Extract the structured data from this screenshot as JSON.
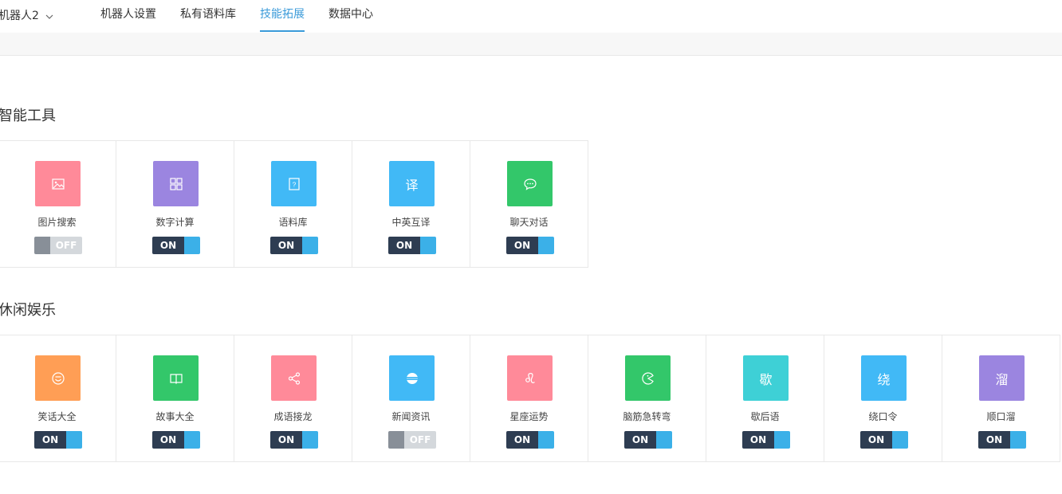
{
  "header": {
    "bot_name": "机器人2",
    "tabs": [
      {
        "label": "机器人设置",
        "active": false
      },
      {
        "label": "私有语料库",
        "active": false
      },
      {
        "label": "技能拓展",
        "active": true
      },
      {
        "label": "数据中心",
        "active": false
      }
    ],
    "accent_color": "#3a9ad9"
  },
  "sections": [
    {
      "title": "智能工具",
      "skills": [
        {
          "label": "图片搜索",
          "icon": "image-icon",
          "color": "#ff8a99",
          "state": "OFF"
        },
        {
          "label": "数字计算",
          "icon": "calculator-icon",
          "color": "#9b85e0",
          "state": "ON"
        },
        {
          "label": "语料库",
          "icon": "question-doc-icon",
          "color": "#41b9f6",
          "state": "ON"
        },
        {
          "label": "中英互译",
          "icon": "translate-icon",
          "glyph": "译",
          "color": "#41b9f6",
          "state": "ON"
        },
        {
          "label": "聊天对话",
          "icon": "chat-bubble-icon",
          "color": "#33c76a",
          "state": "ON"
        }
      ]
    },
    {
      "title": "休闲娱乐",
      "skills": [
        {
          "label": "笑话大全",
          "icon": "smile-icon",
          "color": "#ff9e55",
          "state": "ON"
        },
        {
          "label": "故事大全",
          "icon": "book-icon",
          "color": "#33c76a",
          "state": "ON"
        },
        {
          "label": "成语接龙",
          "icon": "share-nodes-icon",
          "color": "#ff8a99",
          "state": "ON"
        },
        {
          "label": "新闻资讯",
          "icon": "news-globe-icon",
          "color": "#41b9f6",
          "state": "OFF"
        },
        {
          "label": "星座运势",
          "icon": "leo-icon",
          "color": "#ff8a99",
          "state": "ON"
        },
        {
          "label": "脑筋急转弯",
          "icon": "pacman-icon",
          "color": "#33c76a",
          "state": "ON"
        },
        {
          "label": "歇后语",
          "icon": "xie-char-icon",
          "glyph": "歇",
          "color": "#3ed0d6",
          "state": "ON"
        },
        {
          "label": "绕口令",
          "icon": "rao-char-icon",
          "glyph": "绕",
          "color": "#41b9f6",
          "state": "ON"
        },
        {
          "label": "顺口溜",
          "icon": "liu-char-icon",
          "glyph": "溜",
          "color": "#9b85e0",
          "state": "ON"
        }
      ]
    }
  ]
}
